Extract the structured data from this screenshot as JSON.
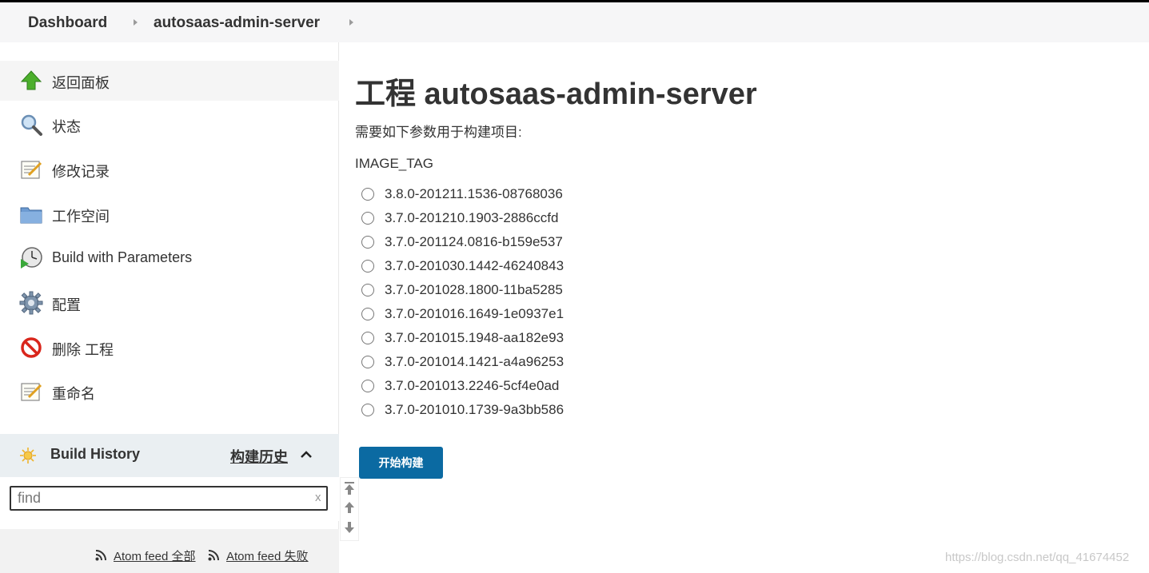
{
  "breadcrumbs": [
    {
      "label": "Dashboard"
    },
    {
      "label": "autosaas-admin-server"
    }
  ],
  "sidebar": {
    "items": [
      {
        "label": "返回面板",
        "icon": "up-arrow-icon"
      },
      {
        "label": "状态",
        "icon": "magnifier-icon"
      },
      {
        "label": "修改记录",
        "icon": "notepad-icon"
      },
      {
        "label": "工作空间",
        "icon": "folder-icon"
      },
      {
        "label": "Build with Parameters",
        "icon": "clock-play-icon"
      },
      {
        "label": "配置",
        "icon": "gear-icon"
      },
      {
        "label": "删除 工程",
        "icon": "no-entry-icon"
      },
      {
        "label": "重命名",
        "icon": "notepad-icon"
      }
    ]
  },
  "build_history": {
    "title": "Build History",
    "link": "构建历史",
    "search_placeholder": "find",
    "clear": "x",
    "feeds": [
      {
        "label": "Atom feed 全部"
      },
      {
        "label": "Atom feed 失败"
      }
    ]
  },
  "main": {
    "title": "工程 autosaas-admin-server",
    "description": "需要如下参数用于构建项目:",
    "param_name": "IMAGE_TAG",
    "options": [
      "3.8.0-201211.1536-08768036",
      "3.7.0-201210.1903-2886ccfd",
      "3.7.0-201124.0816-b159e537",
      "3.7.0-201030.1442-46240843",
      "3.7.0-201028.1800-11ba5285",
      "3.7.0-201016.1649-1e0937e1",
      "3.7.0-201015.1948-aa182e93",
      "3.7.0-201014.1421-a4a96253",
      "3.7.0-201013.2246-5cf4e0ad",
      "3.7.0-201010.1739-9a3bb586"
    ],
    "selected_option": null,
    "build_button": "开始构建"
  },
  "watermark": "https://blog.csdn.net/qq_41674452",
  "colors": {
    "accent": "#0b6aa2",
    "breadcrumb_bg": "#f6f6f7",
    "build_history_bg": "#eaeff2"
  }
}
